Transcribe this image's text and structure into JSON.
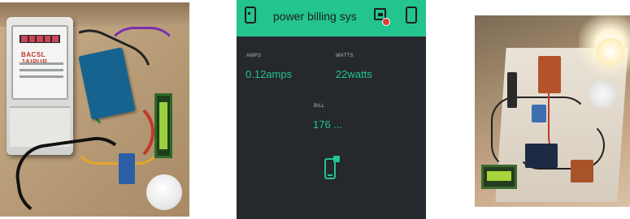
{
  "meter_photo": {
    "brand_text": "BACSL JAIPUR"
  },
  "app": {
    "title": "power billing sys",
    "accent_color": "#23c48e",
    "background_color": "#25282d",
    "header_icons": [
      "device-icon",
      "notification-icon",
      "device-icon"
    ],
    "widgets": {
      "amps": {
        "label": "AMPS",
        "value": "0.12amps"
      },
      "watts": {
        "label": "WATTS",
        "value": "22watts"
      },
      "bill": {
        "label": "BILL",
        "value": "176 ..."
      }
    },
    "bottom_icon": "phone-icon"
  }
}
